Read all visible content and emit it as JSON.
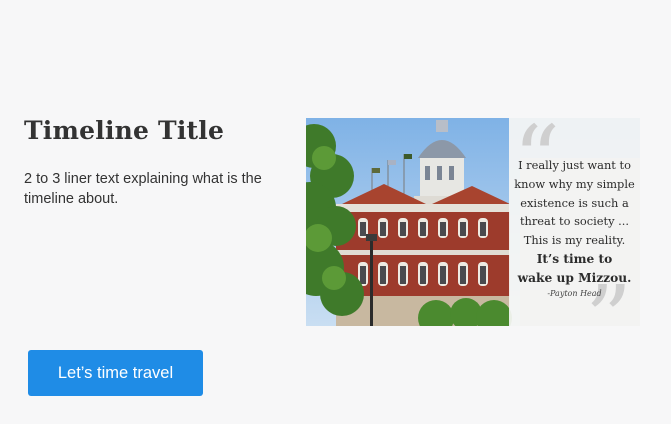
{
  "timeline": {
    "title": "Timeline Title",
    "description": "2 to 3 liner text explaining what is the timeline about."
  },
  "image": {
    "quote_lines": [
      "I really just want to",
      "know why my simple",
      "existence is such a",
      "threat to society ...",
      "This is my reality."
    ],
    "quote_emphasis": [
      "It’s time to",
      "wake up Mizzou."
    ],
    "quote_author": "-Payton Head"
  },
  "cta": {
    "label": "Let’s time travel",
    "color": "#1f8ce6"
  }
}
